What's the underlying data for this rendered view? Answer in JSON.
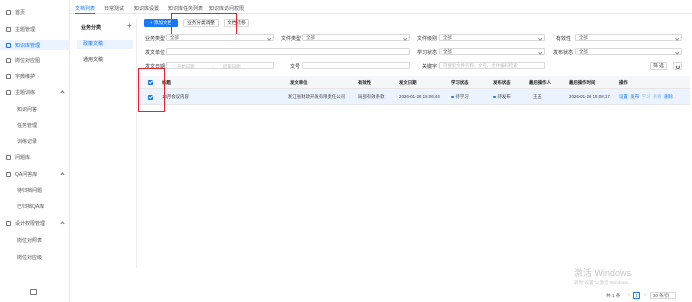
{
  "sidebar": {
    "items": [
      {
        "label": "首页",
        "icon": "home-icon",
        "sub": false
      },
      {
        "label": "主题管理",
        "icon": "grid-icon",
        "sub": false
      },
      {
        "label": "知识库管理",
        "icon": "book-icon",
        "sub": false,
        "active": true
      },
      {
        "label": "岗位对应图",
        "icon": "map-icon",
        "sub": false
      },
      {
        "label": "字典维护",
        "icon": "dict-icon",
        "sub": false
      },
      {
        "label": "主题训练",
        "icon": "train-icon",
        "sub": false,
        "expanded": true
      },
      {
        "label": "知识问答",
        "icon": "",
        "sub": true
      },
      {
        "label": "任务管理",
        "icon": "",
        "sub": true
      },
      {
        "label": "训练记录",
        "icon": "",
        "sub": true
      },
      {
        "label": "问题库",
        "icon": "question-icon",
        "sub": false
      },
      {
        "label": "QA问答库",
        "icon": "qa-icon",
        "sub": false,
        "expanded": true
      },
      {
        "label": "待归档问题",
        "icon": "",
        "sub": true
      },
      {
        "label": "已归档QA库",
        "icon": "",
        "sub": true
      },
      {
        "label": "设计权限管理",
        "icon": "permission-icon",
        "sub": false,
        "expanded": true
      },
      {
        "label": "岗位对照表",
        "icon": "",
        "sub": true
      },
      {
        "label": "岗位对应级",
        "icon": "",
        "sub": true
      }
    ]
  },
  "tabs": [
    "文档列表",
    "日常测试",
    "知识库设置",
    "知识库任务列表",
    "知识库访问权限"
  ],
  "category": {
    "title": "业务分类",
    "add_symbol": "+",
    "items": [
      "政策文稿",
      "通用文稿"
    ]
  },
  "toolbar": {
    "add_doc": "+ 添加文档",
    "adjust_category": "业务分类调整",
    "migrate_doc": "文档迁移"
  },
  "filters": {
    "business_type": {
      "label": "业务类型",
      "value": "全部"
    },
    "doc_type": {
      "label": "文件类型",
      "value": "全部"
    },
    "doc_level": {
      "label": "文件级别",
      "value": "全部"
    },
    "validity": {
      "label": "有效性",
      "value": "全部"
    },
    "issuer": {
      "label": "发文单位",
      "value": ""
    },
    "learn_status": {
      "label": "学习状态",
      "value": "全部"
    },
    "publish_status": {
      "label": "发布状态",
      "value": "全部"
    },
    "issue_date": {
      "label": "发文日期",
      "start_placeholder": "开始日期",
      "separator": "-",
      "end_placeholder": "结束日期"
    },
    "doc_no": {
      "label": "文号",
      "value": ""
    },
    "keyword": {
      "label": "关键字",
      "placeholder": "可搜索文件名称、文号、文件编码检索"
    },
    "query_button": "筛 选"
  },
  "table": {
    "headers": [
      "标题",
      "发文单位",
      "有效性",
      "发文日期",
      "学习状态",
      "发布状态",
      "最后操作人",
      "最后操作时间",
      "操作"
    ],
    "rows": [
      {
        "title": "10月会议内容",
        "issuer": "浙江省财政开发有限责任公司",
        "validity": "局部有效条款",
        "issue_date": "2026-01-26 15:06:44",
        "learn_status": "待学习",
        "publish_status": "待发布",
        "operator": "王五",
        "op_time": "2026-01-26 15:08:17",
        "actions": [
          "设置",
          "发布",
          "学习",
          "查看",
          "删除"
        ]
      }
    ]
  },
  "watermark": {
    "title": "激活 Windows",
    "subtitle": "转到“设置”以激活 Windows。"
  },
  "pagination": {
    "total": "共 1 条",
    "prev": "‹",
    "current_page": "1",
    "next": "›",
    "page_size": "30 条/页"
  },
  "colors": {
    "accent": "#1677ff",
    "highlight_box": "#e8232c",
    "selected_row": "#eaf3ff"
  }
}
